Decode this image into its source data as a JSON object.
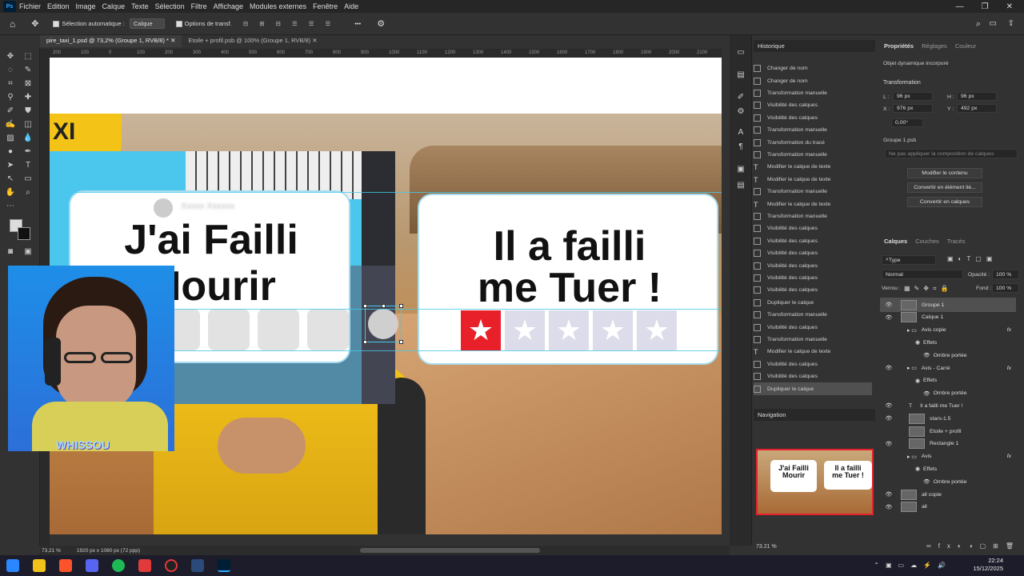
{
  "menu": {
    "app_icon": "Ps",
    "items": [
      "Fichier",
      "Edition",
      "Image",
      "Calque",
      "Texte",
      "Sélection",
      "Filtre",
      "Affichage",
      "Modules externes",
      "Fenêtre",
      "Aide"
    ]
  },
  "options": {
    "auto_select": "Sélection automatique :",
    "layer_mode": "Calque",
    "transform_opts": "Options de transf.",
    "more": "•••"
  },
  "tabs": [
    {
      "label": "pire_taxi_1.psd @ 73,2% (Groupe 1, RVB/8) *"
    },
    {
      "label": "Etoile + profil.psb @ 100% (Groupe 1, RVB/8)"
    }
  ],
  "ruler": {
    "ticks": [
      "200",
      "100",
      "0",
      "100",
      "200",
      "300",
      "400",
      "500",
      "600",
      "700",
      "800",
      "900",
      "1000",
      "1100",
      "1200",
      "1300",
      "1400",
      "1500",
      "1600",
      "1700",
      "1800",
      "1900",
      "2000",
      "2100"
    ]
  },
  "canvas": {
    "left_card": {
      "line1": "J'ai Failli",
      "line2": "Mourir",
      "username": "Xxxxx Xxxxxx"
    },
    "right_card": {
      "line1": "Il a failli",
      "line2": "me Tuer !",
      "stars": [
        "★",
        "★",
        "★",
        "★",
        "★"
      ]
    },
    "taxi_sign": "XI",
    "webcam_label": "WHISSOU"
  },
  "status": {
    "zoom": "73,21 %",
    "doc": "1920 px x 1080 px (72 ppp)"
  },
  "history": {
    "title": "Historique",
    "items": [
      "Changer de nom",
      "Changer de nom",
      "Transformation manuelle",
      "Visibilité des calques",
      "Visibilité des calques",
      "Transformation manuelle",
      "Transformation du tracé",
      "Transformation manuelle",
      "Modifier le calque de texte",
      "Modifier le calque de texte",
      "Transformation manuelle",
      "Modifier le calque de texte",
      "Transformation manuelle",
      "Visibilité des calques",
      "Visibilité des calques",
      "Visibilité des calques",
      "Visibilité des calques",
      "Visibilité des calques",
      "Visibilité des calques",
      "Dupliquer le calque",
      "Transformation manuelle",
      "Visibilité des calques",
      "Transformation manuelle",
      "Modifier le calque de texte",
      "Visibilité des calques",
      "Visibilité des calques",
      "Dupliquer le calque"
    ]
  },
  "navigation": {
    "title": "Navigation",
    "zoom": "73.21 %",
    "mini_left1": "J'ai Failli",
    "mini_left2": "Mourir",
    "mini_right1": "Il a failli",
    "mini_right2": "me Tuer !"
  },
  "properties": {
    "tabs": [
      "Propriétés",
      "Réglages",
      "Couleur"
    ],
    "object": "Objet dynamique incorporé",
    "section": "Transformation",
    "l_label": "L :",
    "l_val": "96 px",
    "h_label": "H :",
    "h_val": "96 px",
    "x_label": "X :",
    "x_val": "976 px",
    "y_label": "Y :",
    "y_val": "492 px",
    "angle": "0,00°",
    "psb": "Groupe 1.psb",
    "comp": "Ne pas appliquer la composition de calques",
    "btn_edit": "Modifier le contenu",
    "btn_linked": "Convertir en élément lié...",
    "btn_layers": "Convertir en calques"
  },
  "layers_panel": {
    "tabs": [
      "Calques",
      "Couches",
      "Tracés"
    ],
    "filter": "Type",
    "blend": "Normal",
    "opacity_label": "Opacité :",
    "opacity": "100 %",
    "lock_label": "Verrou :",
    "fill_label": "Fond :",
    "fill": "100 %",
    "layers": [
      {
        "name": "Groupe 1",
        "kind": "thumb",
        "indent": 0,
        "eye": true
      },
      {
        "name": "Calque 1",
        "kind": "thumb",
        "indent": 0,
        "eye": true
      },
      {
        "name": "Avis copie",
        "kind": "folder",
        "indent": 1,
        "eye": false,
        "fx": "fx"
      },
      {
        "name": "Effets",
        "kind": "sub",
        "indent": 2,
        "eye": false
      },
      {
        "name": "Ombre portée",
        "kind": "sub",
        "indent": 3,
        "eye": false
      },
      {
        "name": "Avis - Carré",
        "kind": "folder",
        "indent": 1,
        "eye": true,
        "fx": "fx"
      },
      {
        "name": "Effets",
        "kind": "sub",
        "indent": 2,
        "eye": false
      },
      {
        "name": "Ombre portée",
        "kind": "sub",
        "indent": 3,
        "eye": false
      },
      {
        "name": "Il a failli me Tuer !",
        "kind": "text",
        "indent": 1,
        "eye": true
      },
      {
        "name": "stars-1.5",
        "kind": "thumb",
        "indent": 1,
        "eye": true
      },
      {
        "name": "Etoile + profil",
        "kind": "thumb",
        "indent": 1,
        "eye": false
      },
      {
        "name": "Rectangle 1",
        "kind": "thumb",
        "indent": 1,
        "eye": true
      },
      {
        "name": "Avis",
        "kind": "folder",
        "indent": 1,
        "eye": false,
        "fx": "fx"
      },
      {
        "name": "Effets",
        "kind": "sub",
        "indent": 2,
        "eye": false
      },
      {
        "name": "Ombre portée",
        "kind": "sub",
        "indent": 3,
        "eye": false
      },
      {
        "name": "all copie",
        "kind": "thumb",
        "indent": 0,
        "eye": true
      },
      {
        "name": "all",
        "kind": "thumb",
        "indent": 0,
        "eye": true
      }
    ]
  },
  "taskbar": {
    "time": "22:24",
    "date": "15/12/2025"
  },
  "colors": {
    "accent": "#e8202a",
    "ps_blue": "#31a8ff",
    "guide": "#44c8e8"
  }
}
